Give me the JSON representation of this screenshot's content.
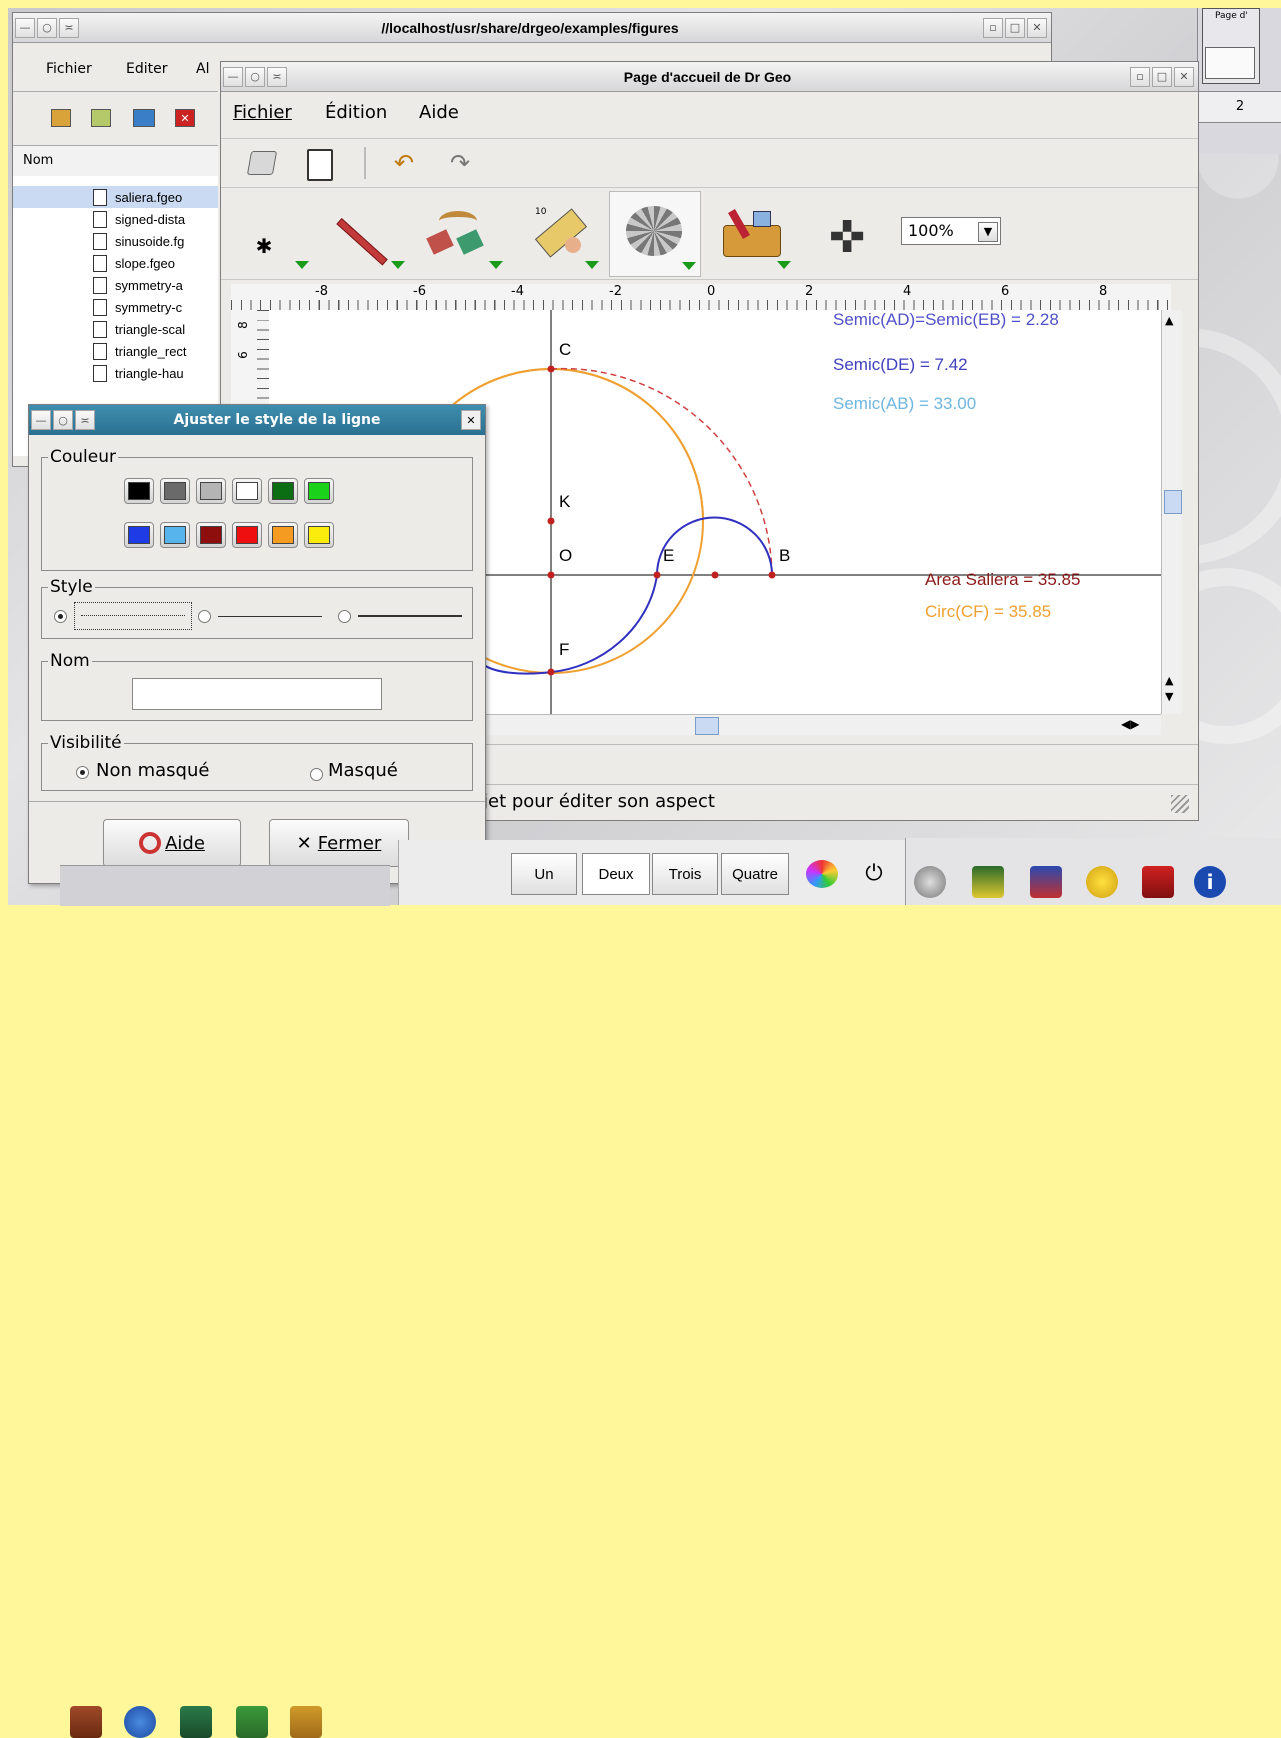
{
  "file_window": {
    "title": "//localhost/usr/share/drgeo/examples/figures",
    "menu": [
      "Fichier",
      "Editer",
      "Al"
    ],
    "column_header": "Nom",
    "files": [
      "saliera.fgeo",
      "signed-dista",
      "sinusoide.fg",
      "slope.fgeo",
      "symmetry-a",
      "symmetry-c",
      "triangle-scal",
      "triangle_rect",
      "triangle-hau"
    ]
  },
  "drgeo_window": {
    "title": "Page d'accueil de Dr Geo",
    "menu": {
      "file": "Fichier",
      "edit": "Édition",
      "help": "Aide"
    },
    "zoom_value": "100%",
    "ruler_labels": [
      "-8",
      "-6",
      "-4",
      "-2",
      "0",
      "2",
      "4",
      "6",
      "8"
    ],
    "vruler_labels": [
      "8",
      "6"
    ],
    "status_text": "jet pour éditer son aspect",
    "canvas": {
      "points": {
        "C": "C",
        "K": "K",
        "O": "O",
        "E": "E",
        "B": "B",
        "F": "F"
      },
      "measures": [
        {
          "text": "Semic(AD)=Semic(EB) = 2.28",
          "color": "#5050c8"
        },
        {
          "text": "Semic(DE) = 7.42",
          "color": "#4040c0"
        },
        {
          "text": "Semic(AB) = 33.00",
          "color": "#6fb6e0"
        },
        {
          "text": "Area Saliera = 35.85",
          "color": "#8b1a1a"
        },
        {
          "text": "Circ(CF) = 35.85",
          "color": "#f0a030"
        }
      ]
    }
  },
  "dialog": {
    "title": "Ajuster le style de la ligne",
    "color_group": "Couleur",
    "colors": [
      "#000000",
      "#6a6a6a",
      "#b4b4b4",
      "#ffffff",
      "#0b6e12",
      "#19d219",
      "#1f3be6",
      "#58b4ec",
      "#8e0d0d",
      "#ee1010",
      "#f59b21",
      "#fbec0e"
    ],
    "style_group": "Style",
    "name_group": "Nom",
    "name_value": "",
    "visibility_group": "Visibilité",
    "visible_label": "Non masqué",
    "hidden_label": "Masqué",
    "help_button": "Aide",
    "close_button": "Fermer"
  },
  "pager": {
    "desktop_label": "Page d'",
    "desktop_number": "2",
    "desktops": [
      "Un",
      "Deux",
      "Trois",
      "Quatre"
    ]
  }
}
